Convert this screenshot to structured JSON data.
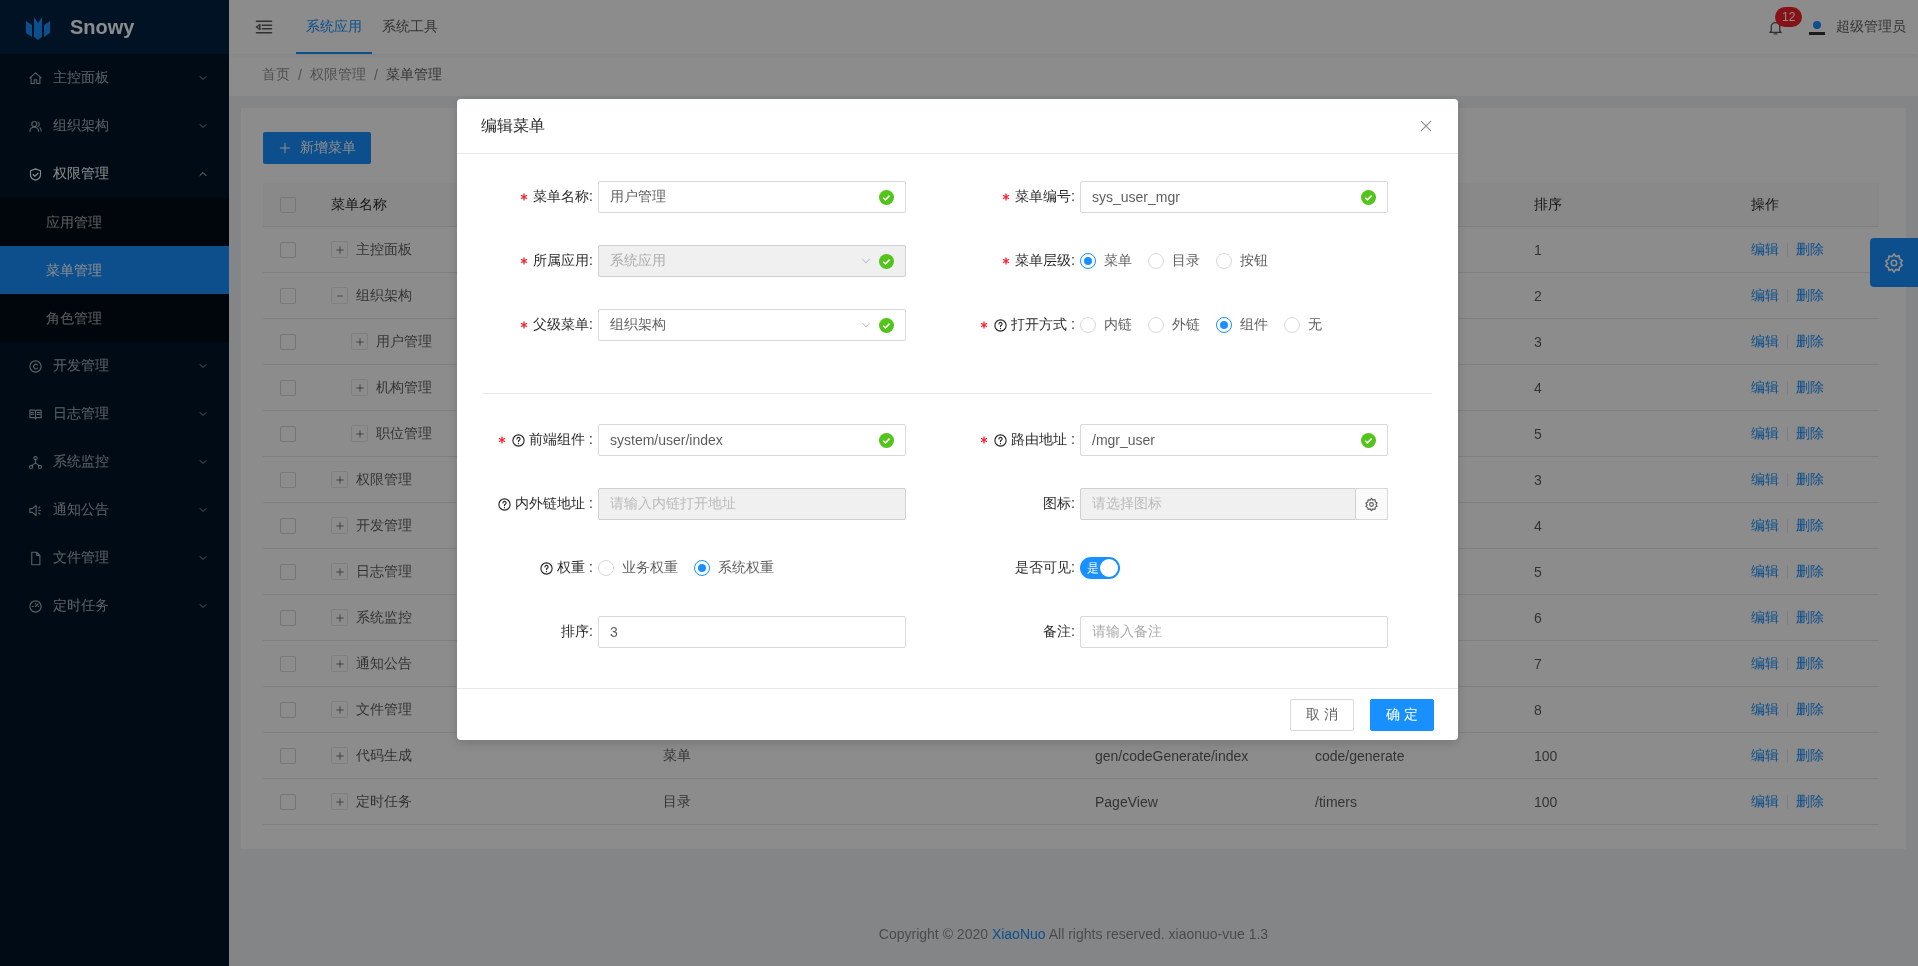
{
  "sidebar": {
    "logo": "Snowy",
    "items": [
      {
        "label": "主控面板",
        "selected": false,
        "expanded": false
      },
      {
        "label": "组织架构",
        "selected": false,
        "expanded": false
      },
      {
        "label": "权限管理",
        "selected": true,
        "expanded": true,
        "children": [
          {
            "label": "应用管理",
            "selected": false
          },
          {
            "label": "菜单管理",
            "selected": true
          },
          {
            "label": "角色管理",
            "selected": false
          }
        ]
      },
      {
        "label": "开发管理",
        "selected": false,
        "expanded": false
      },
      {
        "label": "日志管理",
        "selected": false,
        "expanded": false
      },
      {
        "label": "系统监控",
        "selected": false,
        "expanded": false
      },
      {
        "label": "通知公告",
        "selected": false,
        "expanded": false
      },
      {
        "label": "文件管理",
        "selected": false,
        "expanded": false
      },
      {
        "label": "定时任务",
        "selected": false,
        "expanded": false
      }
    ]
  },
  "header": {
    "tabs": [
      {
        "label": "系统应用",
        "selected": true
      },
      {
        "label": "系统工具",
        "selected": false
      }
    ],
    "notification_count": "12",
    "user": "超级管理员"
  },
  "breadcrumb": {
    "items": [
      "首页",
      "权限管理",
      "菜单管理"
    ],
    "separator": "/"
  },
  "add_button": "新增菜单",
  "table": {
    "all_checked": false,
    "columns": [
      "菜单名称",
      "排序",
      "操作"
    ],
    "rows": [
      {
        "name": "主控面板",
        "checked": false,
        "expanded": false,
        "sort": "1",
        "actions": [
          "编辑",
          "删除"
        ]
      },
      {
        "name": "组织架构",
        "checked": false,
        "expanded": true,
        "sort": "2",
        "actions": [
          "编辑",
          "删除"
        ],
        "children": [
          {
            "name": "用户管理",
            "checked": false,
            "expanded": false,
            "sort": "3",
            "actions": [
              "编辑",
              "删除"
            ]
          },
          {
            "name": "机构管理",
            "checked": false,
            "expanded": false,
            "sort": "4",
            "actions": [
              "编辑",
              "删除"
            ]
          },
          {
            "name": "职位管理",
            "checked": false,
            "expanded": false,
            "sort": "5",
            "actions": [
              "编辑",
              "删除"
            ]
          }
        ]
      },
      {
        "name": "权限管理",
        "checked": false,
        "expanded": false,
        "sort": "3",
        "actions": [
          "编辑",
          "删除"
        ]
      },
      {
        "name": "开发管理",
        "checked": false,
        "expanded": false,
        "sort": "4",
        "actions": [
          "编辑",
          "删除"
        ]
      },
      {
        "name": "日志管理",
        "checked": false,
        "expanded": false,
        "sort": "5",
        "actions": [
          "编辑",
          "删除"
        ]
      },
      {
        "name": "系统监控",
        "checked": false,
        "expanded": false,
        "sort": "6",
        "actions": [
          "编辑",
          "删除"
        ]
      },
      {
        "name": "通知公告",
        "checked": false,
        "expanded": false,
        "sort": "7",
        "actions": [
          "编辑",
          "删除"
        ]
      },
      {
        "name": "文件管理",
        "checked": false,
        "expanded": false,
        "sort": "8",
        "actions": [
          "编辑",
          "删除"
        ]
      },
      {
        "name": "代码生成",
        "checked": false,
        "expanded": false,
        "column_3": "菜单",
        "column_5": "gen/codeGenerate/index",
        "column_6": "code/generate",
        "sort": "100",
        "actions": [
          "编辑",
          "删除"
        ]
      },
      {
        "name": "定时任务",
        "checked": false,
        "expanded": false,
        "column_3": "目录",
        "column_5": "PageView",
        "column_6": "/timers",
        "sort": "100",
        "actions": [
          "编辑",
          "删除"
        ]
      }
    ]
  },
  "footer": {
    "before": "Copyright © 2020",
    "link": "XiaoNuo",
    "after": "All rights reserved. xiaonuo-vue 1.3"
  },
  "dialog": {
    "title": "编辑菜单",
    "sections": [
      {
        "fields": [
          {
            "label": "菜单名称:",
            "required": true,
            "help": false,
            "kind": "input",
            "value": "用户管理",
            "valid": true,
            "disabled": false
          },
          {
            "label": "菜单编号:",
            "required": true,
            "help": false,
            "kind": "input",
            "value": "sys_user_mgr",
            "valid": true,
            "disabled": false
          },
          {
            "label": "所属应用:",
            "required": true,
            "help": false,
            "kind": "select",
            "value": "系统应用",
            "valid": true,
            "disabled": true
          },
          {
            "label": "菜单层级:",
            "required": true,
            "help": false,
            "kind": "radio",
            "options": [
              {
                "label": "菜单",
                "selected": true
              },
              {
                "label": "目录",
                "selected": false
              },
              {
                "label": "按钮",
                "selected": false
              }
            ]
          },
          {
            "label": "父级菜单:",
            "required": true,
            "help": false,
            "kind": "select",
            "value": "组织架构",
            "valid": true,
            "disabled": false
          },
          {
            "label": "打开方式 :",
            "required": true,
            "help": true,
            "kind": "radio",
            "options": [
              {
                "label": "内链",
                "selected": false
              },
              {
                "label": "外链",
                "selected": false
              },
              {
                "label": "组件",
                "selected": true
              },
              {
                "label": "无",
                "selected": false
              }
            ]
          }
        ]
      },
      {
        "fields": [
          {
            "label": "前端组件 :",
            "required": true,
            "help": true,
            "kind": "input",
            "value": "system/user/index",
            "valid": true,
            "disabled": false
          },
          {
            "label": "路由地址 :",
            "required": true,
            "help": true,
            "kind": "input",
            "value": "/mgr_user",
            "valid": true,
            "disabled": false
          },
          {
            "label": "内外链地址 :",
            "required": false,
            "help": true,
            "kind": "input",
            "placeholder": "请输入内链打开地址",
            "valid": false,
            "disabled": true
          },
          {
            "label": "图标:",
            "required": false,
            "help": false,
            "kind": "picker",
            "placeholder": "请选择图标",
            "valid": false,
            "disabled": true
          },
          {
            "label": "权重 :",
            "required": false,
            "help": true,
            "kind": "radio",
            "options": [
              {
                "label": "业务权重",
                "selected": false
              },
              {
                "label": "系统权重",
                "selected": true
              }
            ]
          },
          {
            "label": "是否可见:",
            "required": false,
            "help": false,
            "kind": "switch",
            "on": true,
            "text": "是"
          },
          {
            "label": "排序:",
            "required": false,
            "help": false,
            "kind": "input",
            "value": "3",
            "valid": false,
            "disabled": false
          },
          {
            "label": "备注:",
            "required": false,
            "help": false,
            "kind": "input",
            "placeholder": "请输入备注",
            "valid": false,
            "disabled": false
          }
        ]
      }
    ],
    "buttons": [
      {
        "label": "取 消",
        "primary": false
      },
      {
        "label": "确 定",
        "primary": true
      }
    ]
  }
}
